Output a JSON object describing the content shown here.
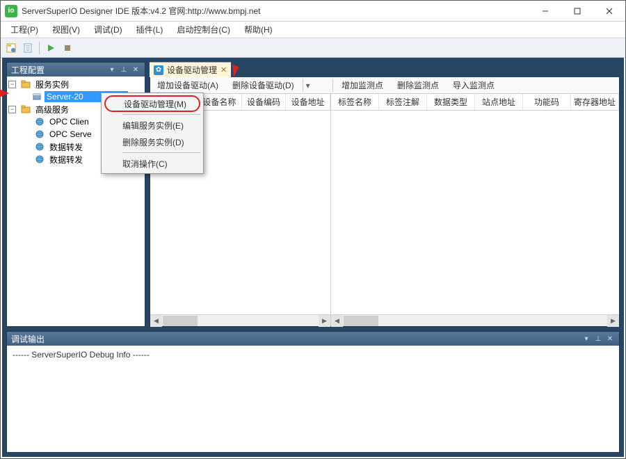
{
  "window": {
    "title": "ServerSuperIO Designer IDE 版本:v4.2 官网:http://www.bmpj.net"
  },
  "menubar": {
    "items": [
      "工程(P)",
      "视图(V)",
      "调试(D)",
      "插件(L)",
      "启动控制台(C)",
      "帮助(H)"
    ]
  },
  "project_panel": {
    "title": "工程配置",
    "tree": {
      "root1": "服务实例",
      "root1_child": "Server-20",
      "root2": "高级服务",
      "r2_children": [
        "OPC Clien",
        "OPC Serve",
        "数据转发",
        "数据转发"
      ]
    }
  },
  "tab": {
    "label": "设备驱动管理"
  },
  "doc_toolbar_left": [
    "增加设备驱动(A)",
    "删除设备驱动(D)"
  ],
  "doc_toolbar_right": [
    "增加监测点",
    "删除监测点",
    "导入监测点"
  ],
  "grid_left_cols": [
    "设备名称",
    "设备编码",
    "设备地址"
  ],
  "grid_right_cols": [
    "标签名称",
    "标签注解",
    "数据类型",
    "站点地址",
    "功能码",
    "寄存器地址"
  ],
  "context_menu": {
    "items": [
      "设备驱动管理(M)",
      "编辑服务实例(E)",
      "删除服务实例(D)",
      "取消操作(C)"
    ]
  },
  "debug_panel": {
    "title": "调试输出",
    "line": "------ ServerSuperIO Debug Info ------"
  }
}
